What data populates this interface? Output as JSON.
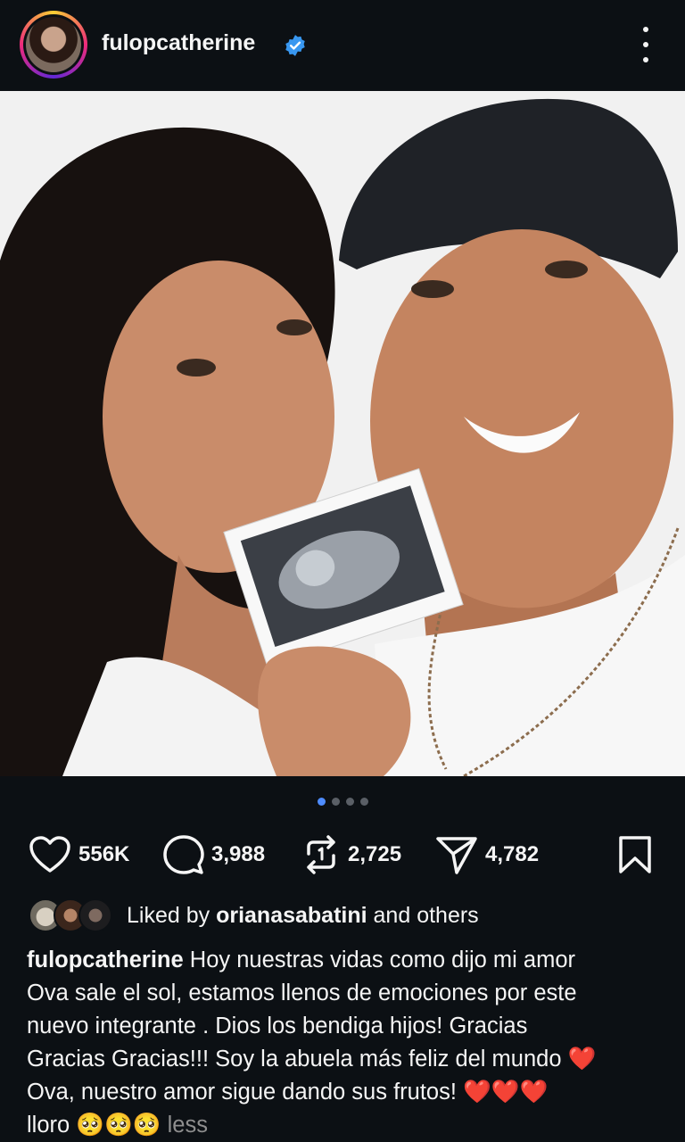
{
  "post": {
    "username": "fulopcatherine",
    "verified": true,
    "more_icon": "more-vertical-icon"
  },
  "carousel": {
    "total": 4,
    "current": 1
  },
  "actions": {
    "likes": "556K",
    "comments": "3,988",
    "reposts": "2,725",
    "shares": "4,782"
  },
  "liked_by": {
    "prefix": "Liked by",
    "user": "oriana sabatini",
    "user_display": "orianasabatini",
    "suffix": "and others"
  },
  "caption": {
    "username": "fulopcatherine",
    "line1": "Hoy nuestras vidas como dijo mi amor",
    "line2": "Ova sale el sol, estamos llenos de emociones por este",
    "line3": "nuevo integrante . Dios los bendiga hijos! Gracias",
    "line4": "Gracias Gracias!!! Soy la abuela más feliz del mundo",
    "emoji_heart": "❤️",
    "line5": "Ova,  nuestro amor sigue dando sus frutos!",
    "emoji_hearts3": "❤️❤️❤️",
    "line6": "lloro",
    "emoji_pleading": "🥺🥺🥺",
    "less": "less"
  },
  "colors": {
    "background": "#0c1014",
    "text": "#f5f5f5",
    "accent": "#4e8cff",
    "muted": "#8e8e8e",
    "heart": "#ff2a52"
  }
}
